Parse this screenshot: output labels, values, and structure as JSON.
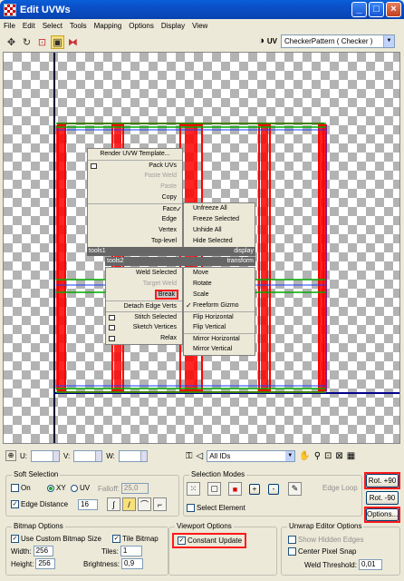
{
  "window": {
    "title": "Edit UVWs"
  },
  "menubar": [
    "File",
    "Edit",
    "Select",
    "Tools",
    "Mapping",
    "Options",
    "Display",
    "View"
  ],
  "toolbar": {
    "uv_label": "UV",
    "texture_select": "CheckerPattern  ( Checker )"
  },
  "context_menu": {
    "top_items": [
      "Render UVW Template...",
      "Pack UVs",
      "Paste Weld",
      "Paste",
      "Copy"
    ],
    "sub_left": [
      "Face",
      "Edge",
      "Vertex",
      "Top-level"
    ],
    "sub_right": [
      "Unfreeze All",
      "Freeze Selected",
      "Unhide All",
      "Hide Selected"
    ],
    "header_tools1": "tools1",
    "header_display": "display",
    "header_tools2": "tools2",
    "header_transform": "transform",
    "tools2_items": [
      "Weld Selected",
      "Target Weld",
      "Break",
      "Detach Edge Verts",
      "Stitch Selected",
      "Sketch Vertices",
      "Relax"
    ],
    "transform_items": [
      "Move",
      "Rotate",
      "Scale",
      "Freeform Gizmo",
      "Flip Horizontal",
      "Flip Vertical",
      "Mirror Horizontal",
      "Mirror Vertical"
    ]
  },
  "status": {
    "u_label": "U:",
    "v_label": "V:",
    "w_label": "W:",
    "ids_select": "All IDs"
  },
  "soft_selection": {
    "title": "Soft Selection",
    "on": "On",
    "xy": "XY",
    "uv": "UV",
    "falloff_label": "Falloff:",
    "falloff_value": "25,0",
    "edge_distance": "Edge Distance",
    "edge_distance_value": "16"
  },
  "selection_modes": {
    "title": "Selection Modes",
    "select_element": "Select Element",
    "plus": "+",
    "minus": "-",
    "edge_loop": "Edge Loop"
  },
  "rotate": {
    "rot_plus": "Rot. +90",
    "rot_minus": "Rot. -90",
    "options": "Options..."
  },
  "bitmap_options": {
    "title": "Bitmap Options",
    "use_custom": "Use Custom Bitmap Size",
    "tile_bitmap": "Tile Bitmap",
    "width_label": "Width:",
    "width_value": "256",
    "height_label": "Height:",
    "height_value": "256",
    "tiles_label": "Tiles:",
    "tiles_value": "1",
    "brightness_label": "Brightness:",
    "brightness_value": "0,9"
  },
  "viewport_options": {
    "title": "Viewport Options",
    "constant_update": "Constant Update"
  },
  "unwrap_options": {
    "title": "Unwrap Editor Options",
    "show_hidden_edges": "Show Hidden Edges",
    "center_pixel_snap": "Center Pixel Snap",
    "weld_threshold_label": "Weld Threshold:",
    "weld_threshold_value": "0,01"
  }
}
